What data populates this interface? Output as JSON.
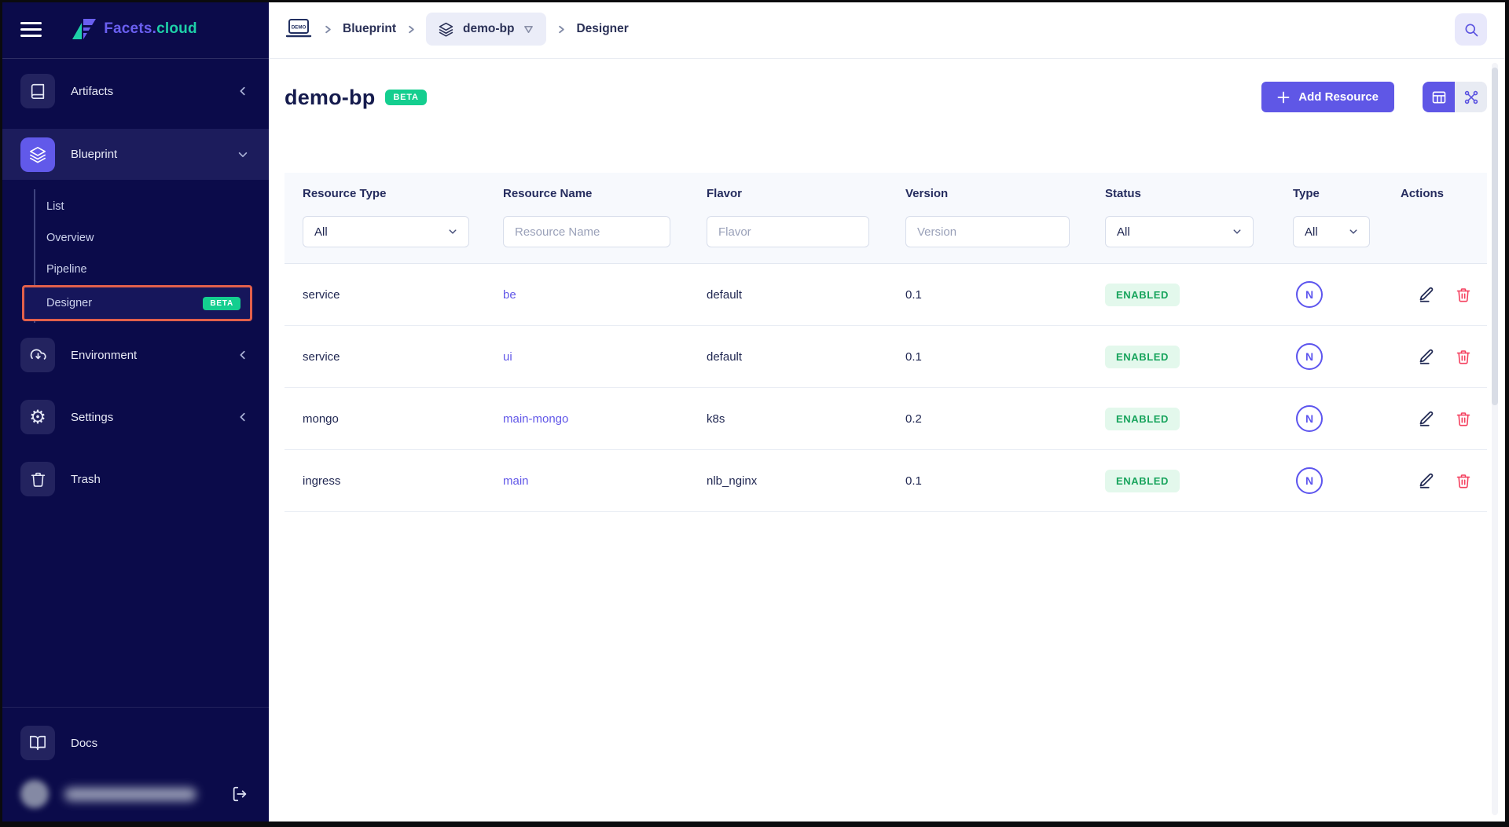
{
  "colors": {
    "accent_purple": "#5f57e6",
    "brand_purple": "#6a5ff0",
    "brand_teal": "#1ed0a8",
    "beta_green": "#14ce8f",
    "status_green": "#17a45c",
    "status_bg": "#e3f8ec",
    "danger_red": "#f43f5e",
    "highlight_orange": "#e2604b",
    "sidebar_bg": "#0b0b4a"
  },
  "sidebar": {
    "brand": {
      "name_primary": "Facets.",
      "name_secondary": "cloud"
    },
    "items": [
      {
        "label": "Artifacts"
      },
      {
        "label": "Blueprint"
      },
      {
        "label": "Environment"
      },
      {
        "label": "Settings"
      },
      {
        "label": "Trash"
      }
    ],
    "blueprint_children": [
      {
        "label": "List"
      },
      {
        "label": "Overview"
      },
      {
        "label": "Pipeline"
      },
      {
        "label": "Designer",
        "badge": "BETA"
      }
    ],
    "docs_label": "Docs"
  },
  "topbar": {
    "breadcrumb": {
      "demo_text": "DEMO",
      "item1": "Blueprint",
      "item2": "demo-bp",
      "item3": "Designer"
    }
  },
  "page": {
    "title": "demo-bp",
    "beta_badge": "BETA",
    "add_resource_label": "Add Resource"
  },
  "table": {
    "columns": [
      "Resource Type",
      "Resource Name",
      "Flavor",
      "Version",
      "Status",
      "Type",
      "Actions"
    ],
    "filters": {
      "resource_type_value": "All",
      "resource_name_placeholder": "Resource Name",
      "flavor_placeholder": "Flavor",
      "version_placeholder": "Version",
      "status_value": "All",
      "type_value": "All"
    },
    "rows": [
      {
        "resource_type": "service",
        "resource_name": "be",
        "flavor": "default",
        "version": "0.1",
        "status": "ENABLED",
        "type_badge": "N"
      },
      {
        "resource_type": "service",
        "resource_name": "ui",
        "flavor": "default",
        "version": "0.1",
        "status": "ENABLED",
        "type_badge": "N"
      },
      {
        "resource_type": "mongo",
        "resource_name": "main-mongo",
        "flavor": "k8s",
        "version": "0.2",
        "status": "ENABLED",
        "type_badge": "N"
      },
      {
        "resource_type": "ingress",
        "resource_name": "main",
        "flavor": "nlb_nginx",
        "version": "0.1",
        "status": "ENABLED",
        "type_badge": "N"
      }
    ]
  }
}
